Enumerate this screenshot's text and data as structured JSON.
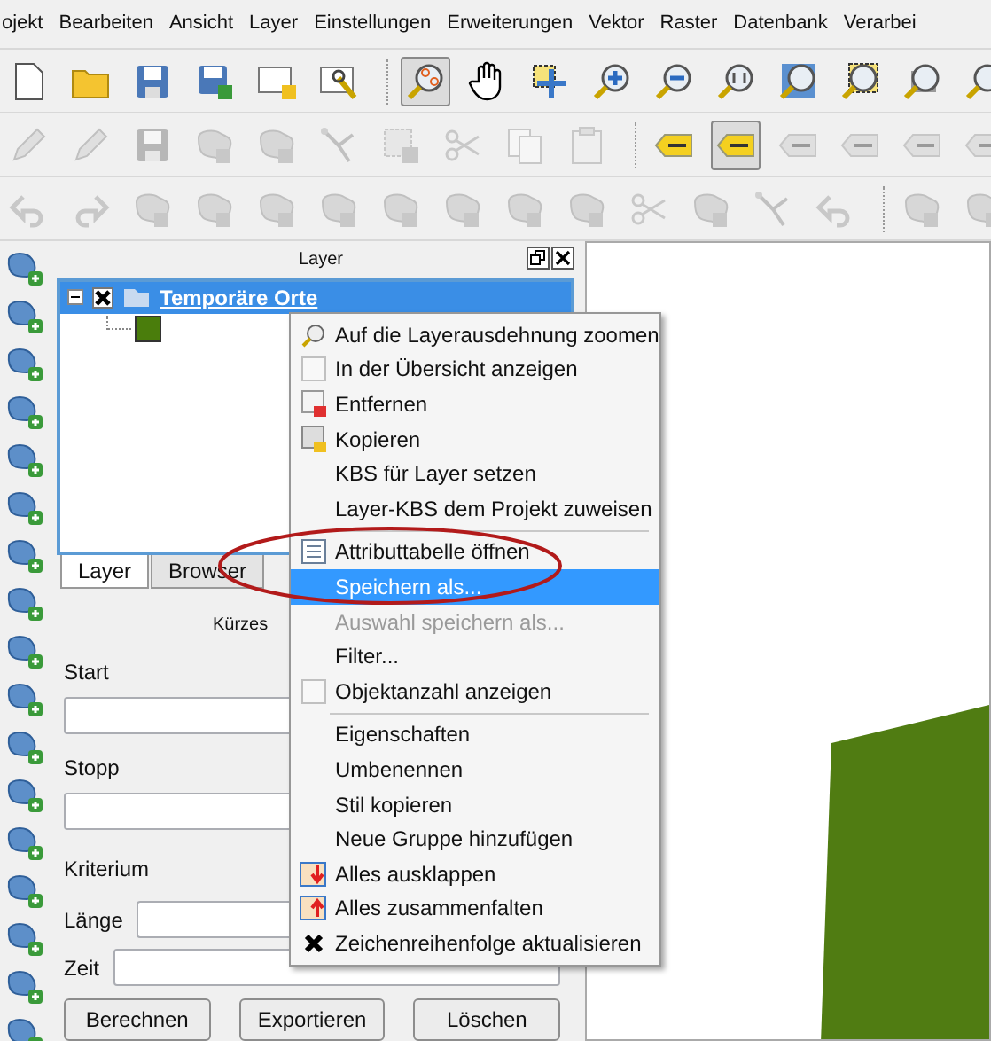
{
  "menu_bar": [
    "ojekt",
    "Bearbeiten",
    "Ansicht",
    "Layer",
    "Einstellungen",
    "Erweiterungen",
    "Vektor",
    "Raster",
    "Datenbank",
    "Verarbei"
  ],
  "toolbars": [
    {
      "buttons": [
        {
          "kind": "file",
          "disabled": false,
          "selected": false
        },
        {
          "kind": "folder",
          "disabled": false,
          "selected": false
        },
        {
          "kind": "save",
          "disabled": false,
          "selected": false
        },
        {
          "kind": "save-edit",
          "disabled": false,
          "selected": false
        },
        {
          "kind": "new-layer",
          "disabled": false,
          "selected": false
        },
        {
          "kind": "properties",
          "disabled": false,
          "selected": false
        },
        {
          "kind": "separator"
        },
        {
          "kind": "zoom-pan",
          "disabled": false,
          "selected": true
        },
        {
          "kind": "pan",
          "disabled": false,
          "selected": false
        },
        {
          "kind": "select",
          "disabled": false,
          "selected": false
        },
        {
          "kind": "zoom-in",
          "disabled": false,
          "selected": false
        },
        {
          "kind": "zoom-out",
          "disabled": false,
          "selected": false
        },
        {
          "kind": "zoom-actual",
          "disabled": false,
          "selected": false
        },
        {
          "kind": "zoom-full",
          "disabled": false,
          "selected": false
        },
        {
          "kind": "zoom-selection",
          "disabled": false,
          "selected": false
        },
        {
          "kind": "zoom-layer",
          "disabled": false,
          "selected": false
        },
        {
          "kind": "zoom-last",
          "disabled": false,
          "selected": false
        }
      ]
    },
    {
      "buttons": [
        {
          "kind": "pencil",
          "disabled": true,
          "selected": false
        },
        {
          "kind": "pencil",
          "disabled": true,
          "selected": false
        },
        {
          "kind": "save",
          "disabled": true,
          "selected": false
        },
        {
          "kind": "shape",
          "disabled": true,
          "selected": false
        },
        {
          "kind": "shape",
          "disabled": true,
          "selected": false
        },
        {
          "kind": "node",
          "disabled": true,
          "selected": false
        },
        {
          "kind": "delete",
          "disabled": true,
          "selected": false
        },
        {
          "kind": "scissors",
          "disabled": true,
          "selected": false
        },
        {
          "kind": "copy",
          "disabled": true,
          "selected": false
        },
        {
          "kind": "paste",
          "disabled": true,
          "selected": false
        },
        {
          "kind": "separator"
        },
        {
          "kind": "label",
          "disabled": false,
          "selected": false
        },
        {
          "kind": "label",
          "disabled": false,
          "selected": true
        },
        {
          "kind": "label",
          "disabled": true,
          "selected": false
        },
        {
          "kind": "label",
          "disabled": true,
          "selected": false
        },
        {
          "kind": "label",
          "disabled": true,
          "selected": false
        },
        {
          "kind": "label",
          "disabled": true,
          "selected": false
        }
      ]
    },
    {
      "buttons": [
        {
          "kind": "undo",
          "disabled": true,
          "selected": false
        },
        {
          "kind": "redo",
          "disabled": true,
          "selected": false
        },
        {
          "kind": "shape",
          "disabled": true,
          "selected": false
        },
        {
          "kind": "shape",
          "disabled": true,
          "selected": false
        },
        {
          "kind": "shape",
          "disabled": true,
          "selected": false
        },
        {
          "kind": "shape",
          "disabled": true,
          "selected": false
        },
        {
          "kind": "shape",
          "disabled": true,
          "selected": false
        },
        {
          "kind": "shape",
          "disabled": true,
          "selected": false
        },
        {
          "kind": "shape",
          "disabled": true,
          "selected": false
        },
        {
          "kind": "shape",
          "disabled": true,
          "selected": false
        },
        {
          "kind": "scissors",
          "disabled": true,
          "selected": false
        },
        {
          "kind": "shape",
          "disabled": true,
          "selected": false
        },
        {
          "kind": "node",
          "disabled": true,
          "selected": false
        },
        {
          "kind": "undo",
          "disabled": true,
          "selected": false
        },
        {
          "kind": "separator"
        },
        {
          "kind": "shape",
          "disabled": true,
          "selected": false
        },
        {
          "kind": "shape",
          "disabled": true,
          "selected": false
        }
      ]
    }
  ],
  "layer_panel": {
    "title": "Layer",
    "tree": [
      {
        "label": "Temporäre Orte",
        "selected": true,
        "expanded": true,
        "visible": true,
        "color": "#4a7d0c"
      }
    ],
    "tabs": [
      {
        "label": "Layer",
        "selected": true
      },
      {
        "label": "Browser",
        "selected": false
      }
    ]
  },
  "route_panel": {
    "title": "Kürzes",
    "fields": [
      {
        "label": "Start",
        "kind": "stacked"
      },
      {
        "label": "Stopp",
        "kind": "stacked"
      },
      {
        "label": "Kriterium",
        "kind": "heading"
      },
      {
        "label": "Länge",
        "kind": "inline"
      },
      {
        "label": "Zeit",
        "kind": "inline"
      }
    ],
    "buttons": [
      "Berechnen",
      "Exportieren",
      "Löschen"
    ]
  },
  "context_menu": [
    {
      "kind": "zoom",
      "label": "Auf die Layerausdehnung zoomen",
      "selected": false,
      "disabled": false
    },
    {
      "kind": "checkbox",
      "label": "In der Übersicht anzeigen",
      "checked": false,
      "selected": false,
      "disabled": false
    },
    {
      "kind": "remove",
      "label": "Entfernen",
      "selected": false,
      "disabled": false
    },
    {
      "kind": "copy",
      "label": "Kopieren",
      "selected": false,
      "disabled": false
    },
    {
      "kind": "plain",
      "label": "KBS für Layer setzen",
      "selected": false,
      "disabled": false
    },
    {
      "kind": "plain",
      "label": "Layer-KBS dem Projekt zuweisen",
      "selected": false,
      "disabled": false
    },
    {
      "kind": "separator"
    },
    {
      "kind": "table",
      "label": "Attributtabelle öffnen",
      "selected": false,
      "disabled": false
    },
    {
      "kind": "plain",
      "label": "Speichern als...",
      "selected": true,
      "disabled": false
    },
    {
      "kind": "plain",
      "label": "Auswahl speichern als...",
      "selected": false,
      "disabled": true
    },
    {
      "kind": "plain",
      "label": "Filter...",
      "selected": false,
      "disabled": false
    },
    {
      "kind": "checkbox",
      "label": "Objektanzahl anzeigen",
      "checked": false,
      "selected": false,
      "disabled": false
    },
    {
      "kind": "separator"
    },
    {
      "kind": "plain",
      "label": "Eigenschaften",
      "selected": false,
      "disabled": false
    },
    {
      "kind": "plain",
      "label": "Umbenennen",
      "selected": false,
      "disabled": false
    },
    {
      "kind": "plain",
      "label": "Stil kopieren",
      "selected": false,
      "disabled": false
    },
    {
      "kind": "plain",
      "label": "Neue Gruppe hinzufügen",
      "selected": false,
      "disabled": false
    },
    {
      "kind": "expand",
      "label": "Alles ausklappen",
      "selected": false,
      "disabled": false
    },
    {
      "kind": "collapse",
      "label": "Alles zusammenfalten",
      "selected": false,
      "disabled": false
    },
    {
      "kind": "checkbox",
      "label": "Zeichenreihenfolge aktualisieren",
      "checked": true,
      "selected": false,
      "disabled": false
    }
  ],
  "map": {
    "features": [
      {
        "kind": "polygon",
        "color": "#507c12"
      }
    ]
  }
}
